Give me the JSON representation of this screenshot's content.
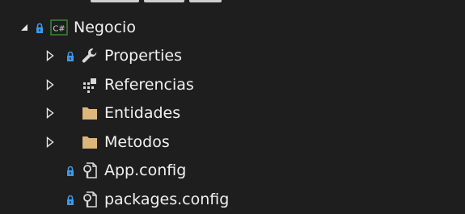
{
  "solution_explorer": {
    "project": {
      "name": "Negocio",
      "icon": "csharp-project-icon",
      "lock_icon": "lock-icon",
      "expanded": true
    },
    "items": [
      {
        "label": "Properties",
        "icon": "wrench-icon",
        "locked": true,
        "expandable": true
      },
      {
        "label": "Referencias",
        "icon": "references-icon",
        "locked": false,
        "expandable": true
      },
      {
        "label": "Entidades",
        "icon": "folder-icon",
        "locked": false,
        "expandable": true
      },
      {
        "label": "Metodos",
        "icon": "folder-icon",
        "locked": false,
        "expandable": true
      },
      {
        "label": "App.config",
        "icon": "config-file-icon",
        "locked": true,
        "expandable": false
      },
      {
        "label": "packages.config",
        "icon": "config-file-icon",
        "locked": true,
        "expandable": false
      }
    ]
  },
  "colors": {
    "background": "#1e1e1e",
    "text": "#f1f1f1",
    "lock": "#3c9ae8",
    "folder": "#dcb67a",
    "csharp_border": "#368832",
    "arrow": "#e8e8e8"
  }
}
